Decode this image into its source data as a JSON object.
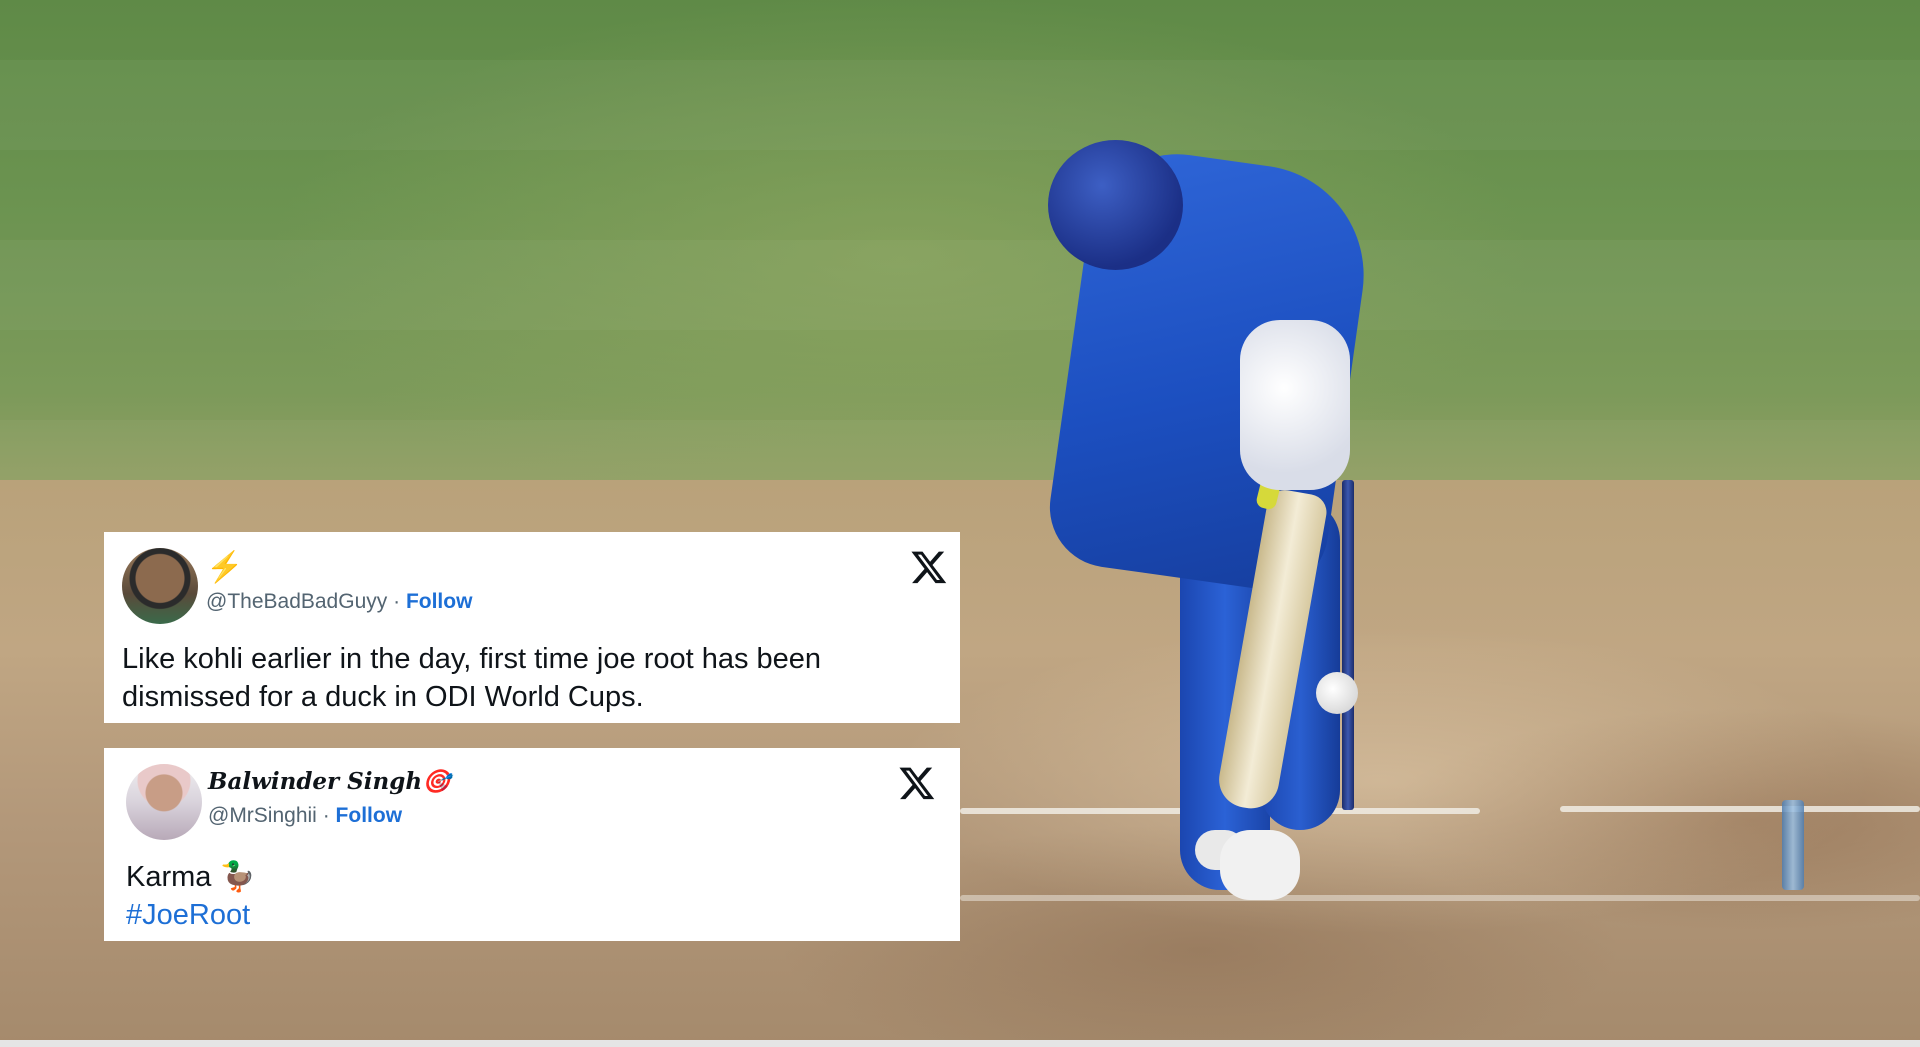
{
  "tweets": [
    {
      "display_name": "⚡",
      "handle": "@TheBadBadGuyy",
      "separator": "·",
      "follow_label": "Follow",
      "text_line_1": "Like kohli earlier in the day, first time joe root has been",
      "text_line_2": "dismissed for a duck in ODI World Cups."
    },
    {
      "display_name": "Balwinder Singh🎯",
      "handle": "@MrSinghii",
      "separator": "·",
      "follow_label": "Follow",
      "text_line_1": "Karma 🦆",
      "hashtag": "#JoeRoot"
    }
  ],
  "colors": {
    "link": "#1d6fd6",
    "text": "#0f1419",
    "muted": "#536471",
    "lightning": "#f5b014"
  },
  "icons": [
    "x-logo-icon",
    "avatar",
    "lightning-emoji",
    "duck-emoji"
  ]
}
